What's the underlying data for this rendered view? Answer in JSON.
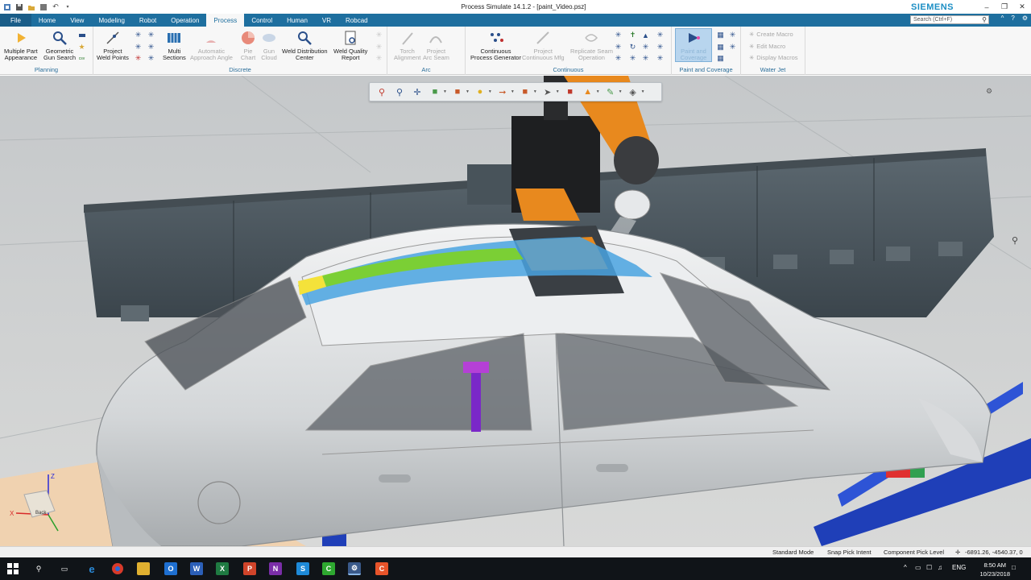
{
  "window": {
    "title": "Process Simulate 14.1.2 - [paint_Video.psz]",
    "brand": "SIEMENS",
    "search_placeholder": "Search (Ctrl+F)"
  },
  "tabs": [
    "File",
    "Home",
    "View",
    "Modeling",
    "Robot",
    "Operation",
    "Process",
    "Control",
    "Human",
    "VR",
    "Robcad"
  ],
  "active_tab": "Process",
  "ribbon": {
    "planning": {
      "label": "Planning",
      "b1": [
        "Multiple Part",
        "Appearance"
      ],
      "b2": [
        "Geometric",
        "Gun Search"
      ],
      "csv": "csv"
    },
    "discrete": {
      "label": "Discrete",
      "b1": [
        "Project",
        "Weld Points"
      ],
      "b2": [
        "Multi",
        "Sections"
      ],
      "b3": [
        "Automatic",
        "Approach Angle"
      ],
      "b4": [
        "Pie",
        "Chart"
      ],
      "b5": [
        "Gun",
        "Cloud"
      ],
      "b6": [
        "Weld Distribution",
        "Center"
      ],
      "b7": [
        "Weld Quality",
        "Report"
      ]
    },
    "arc": {
      "label": "Arc",
      "b1": [
        "Torch",
        "Alignment"
      ],
      "b2": [
        "Project",
        "Arc Seam"
      ]
    },
    "continuous": {
      "label": "Continuous",
      "b1": [
        "Continuous",
        "Process Generator"
      ],
      "b2": [
        "Project",
        "Continuous Mfg"
      ],
      "b3": [
        "Replicate Seam",
        "Operation"
      ]
    },
    "paint": {
      "label": "Paint and Coverage",
      "b1": [
        "Paint and",
        "Coverage"
      ]
    },
    "waterjet": {
      "label": "Water Jet",
      "items": [
        "Create Macro",
        "Edit Macro",
        "Display Macros"
      ]
    }
  },
  "viewport": {
    "triad": {
      "x": "X",
      "z": "Z",
      "face": "Back"
    }
  },
  "statusbar": {
    "mode": "Standard Mode",
    "pick_intent": "Snap Pick Intent",
    "pick_level": "Component Pick Level",
    "coords": "-6891.26, -4540.37, 0"
  },
  "taskbar": {
    "lang": "ENG",
    "time": "8:50 AM",
    "date": "10/23/2018"
  },
  "colors": {
    "tab_blue": "#1e6f9f",
    "group_label": "#2b6e9a",
    "robot_orange": "#e8891e",
    "paint_blue": "#4aa3e0",
    "paint_green": "#7ed321"
  }
}
